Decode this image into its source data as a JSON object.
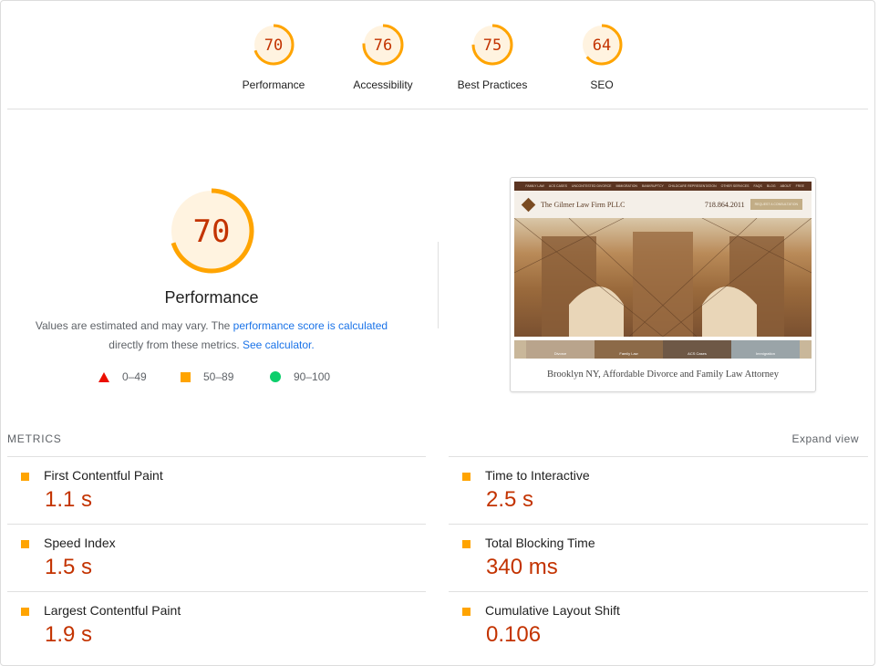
{
  "categories": [
    {
      "label": "Performance",
      "score": 70
    },
    {
      "label": "Accessibility",
      "score": 76
    },
    {
      "label": "Best Practices",
      "score": 75
    },
    {
      "label": "SEO",
      "score": 64
    }
  ],
  "colors": {
    "average": "#ffa400",
    "fail": "#eb0f00",
    "pass": "#0cce6b",
    "score_text": "#c33300",
    "gauge_bg": "#fff3e0",
    "link": "#1a73e8"
  },
  "main_gauge": {
    "score": 70,
    "label": "Performance"
  },
  "description": {
    "text1": "Values are estimated and may vary. The ",
    "link1": "performance score is calculated",
    "text2": " directly from these metrics. ",
    "link2": "See calculator."
  },
  "legend": [
    {
      "icon": "triangle-icon",
      "range": "0–49"
    },
    {
      "icon": "square-icon",
      "range": "50–89"
    },
    {
      "icon": "circle-icon",
      "range": "90–100"
    }
  ],
  "screenshot": {
    "nav": [
      "FAMILY LAW",
      "ACS CASES",
      "UNCONTESTED DIVORCE",
      "IMMIGRATION",
      "BANKRUPTCY",
      "CHILDCARE REPRESENTATION",
      "OTHER SERVICES",
      "FAQS",
      "BLOG",
      "ABOUT",
      "FREE"
    ],
    "firm": "The Gilmer Law Firm PLLC",
    "phone": "718.864.2011",
    "cta": "REQUEST A CONSULTATION",
    "thumbs": [
      "Divorce",
      "Family Law",
      "ACS Cases",
      "Immigration"
    ],
    "tagline": "Brooklyn NY, Affordable Divorce and Family Law Attorney"
  },
  "metrics_header": "METRICS",
  "expand_view": "Expand view",
  "metrics": [
    {
      "title": "First Contentful Paint",
      "value": "1.1 s"
    },
    {
      "title": "Time to Interactive",
      "value": "2.5 s"
    },
    {
      "title": "Speed Index",
      "value": "1.5 s"
    },
    {
      "title": "Total Blocking Time",
      "value": "340 ms"
    },
    {
      "title": "Largest Contentful Paint",
      "value": "1.9 s"
    },
    {
      "title": "Cumulative Layout Shift",
      "value": "0.106"
    }
  ]
}
